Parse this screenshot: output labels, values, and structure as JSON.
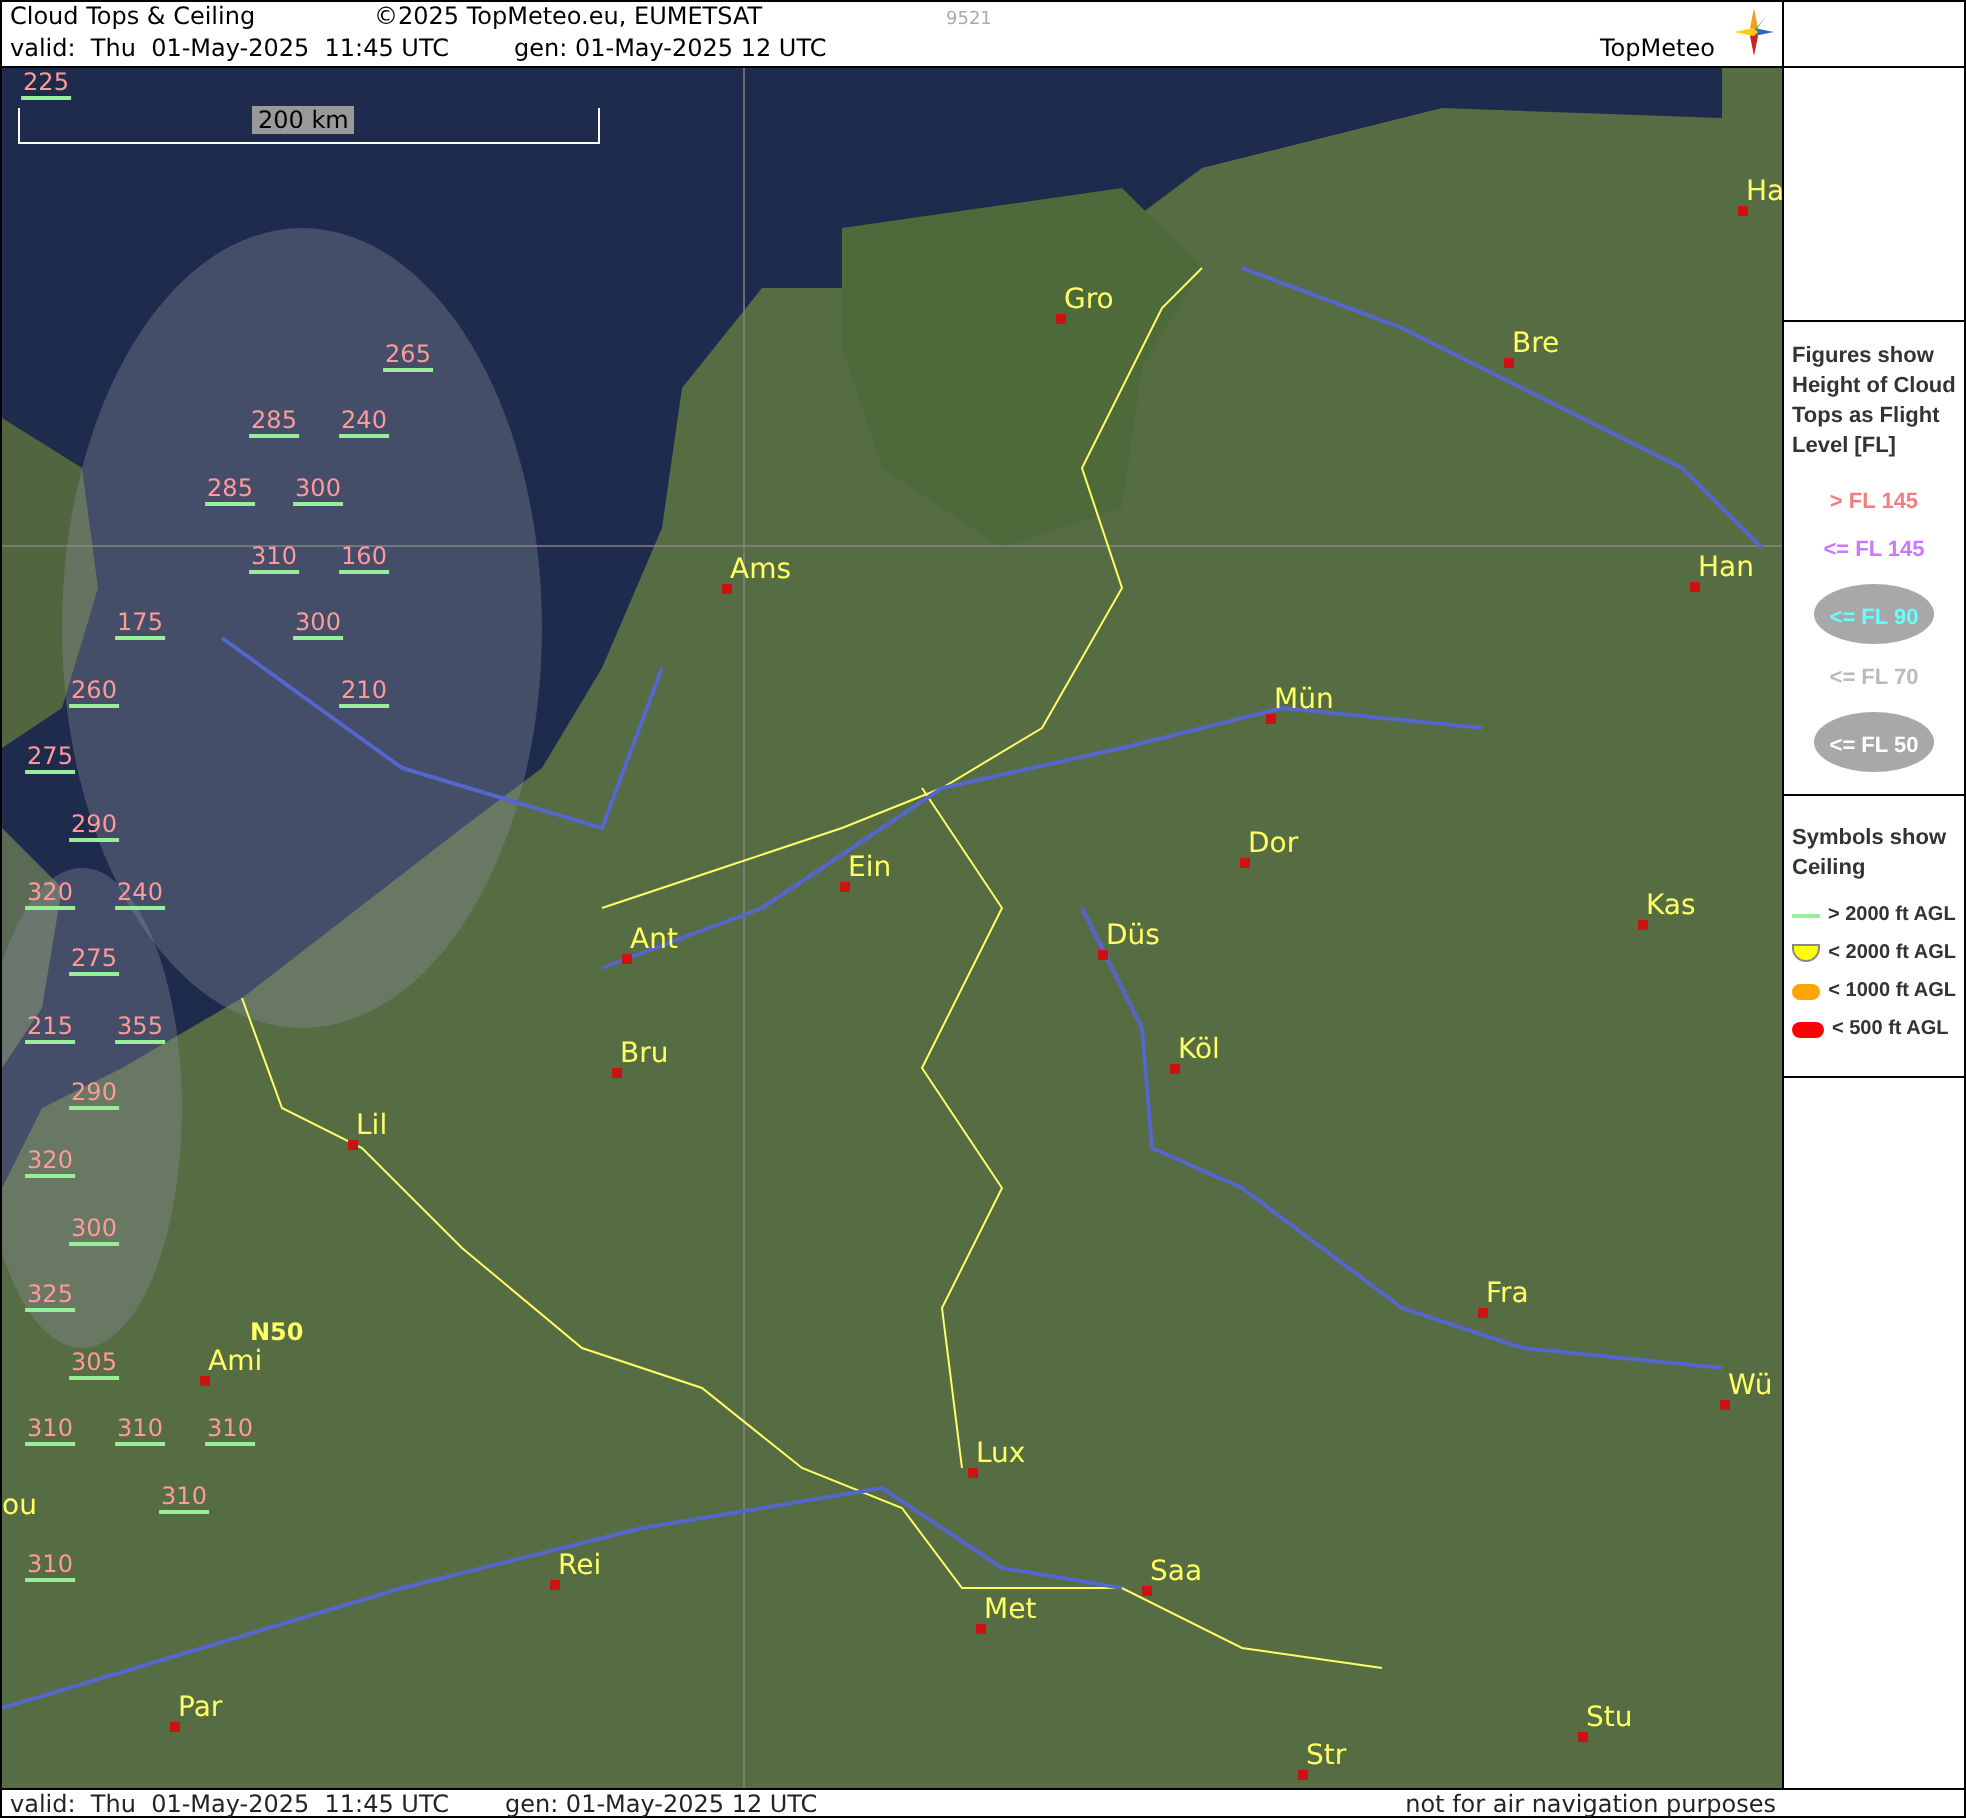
{
  "header": {
    "title": "Cloud Tops & Ceiling",
    "copyright": "©2025 TopMeteo.eu, EUMETSAT",
    "code": "9521",
    "valid": "valid:  Thu  01-May-2025  11:45 UTC",
    "generated": "gen: 01-May-2025 12 UTC",
    "logo": "TopMeteo"
  },
  "map": {
    "scale_label": "200 km",
    "figures": [
      "225",
      "265",
      "285",
      "240",
      "285",
      "300",
      "310",
      "160",
      "175",
      "300",
      "260",
      "210",
      "275",
      "290",
      "320",
      "240",
      "275",
      "215",
      "355",
      "290",
      "320",
      "300",
      "325",
      "305",
      "310",
      "310",
      "310",
      "310",
      "310"
    ],
    "places": [
      {
        "name": "Ha",
        "kind": "city"
      },
      {
        "name": "Gro",
        "kind": "city"
      },
      {
        "name": "Bre",
        "kind": "city"
      },
      {
        "name": "Ams",
        "kind": "city"
      },
      {
        "name": "Han",
        "kind": "city"
      },
      {
        "name": "Mün",
        "kind": "city"
      },
      {
        "name": "Dor",
        "kind": "city"
      },
      {
        "name": "Ein",
        "kind": "city"
      },
      {
        "name": "Kas",
        "kind": "city"
      },
      {
        "name": "Düs",
        "kind": "city"
      },
      {
        "name": "Ant",
        "kind": "city"
      },
      {
        "name": "Köl",
        "kind": "city"
      },
      {
        "name": "Bru",
        "kind": "city"
      },
      {
        "name": "Lil",
        "kind": "city"
      },
      {
        "name": "Fra",
        "kind": "city"
      },
      {
        "name": "N50",
        "kind": "grid"
      },
      {
        "name": "Ami",
        "kind": "city"
      },
      {
        "name": "Wü",
        "kind": "city"
      },
      {
        "name": "Lux",
        "kind": "city"
      },
      {
        "name": "ou",
        "kind": "cut"
      },
      {
        "name": "Saa",
        "kind": "city"
      },
      {
        "name": "Rei",
        "kind": "city"
      },
      {
        "name": "Met",
        "kind": "city"
      },
      {
        "name": "Stu",
        "kind": "city"
      },
      {
        "name": "Par",
        "kind": "city"
      },
      {
        "name": "Str",
        "kind": "city"
      }
    ]
  },
  "legend": {
    "figures_heading": "Figures show Height of Cloud Tops as Flight Level  [FL]",
    "figure_levels": [
      {
        "label": "> FL 145",
        "color": "#f08080",
        "oval": false
      },
      {
        "label": "<= FL 145",
        "color": "#cc77ff",
        "oval": false
      },
      {
        "label": "<= FL 90",
        "color": "#66ffff",
        "oval": true
      },
      {
        "label": "<= FL 70",
        "color": "#bbbbbb",
        "oval": false
      },
      {
        "label": "<= FL 50",
        "color": "#ffffff",
        "oval": true
      }
    ],
    "symbols_heading": "Symbols show Ceiling",
    "ceiling_symbols": [
      {
        "label": "> 2000 ft AGL",
        "kind": "line",
        "color": "#99ee99"
      },
      {
        "label": "< 2000 ft AGL",
        "kind": "bowl",
        "color": "#ffff00"
      },
      {
        "label": "< 1000 ft AGL",
        "kind": "pill",
        "color": "#ffa500"
      },
      {
        "label": "< 500 ft AGL",
        "kind": "pill",
        "color": "#ff0000"
      }
    ]
  },
  "footer": {
    "valid": "valid:  Thu  01-May-2025  11:45 UTC",
    "generated": "gen: 01-May-2025 12 UTC",
    "disclaimer": "not for air navigation purposes"
  }
}
